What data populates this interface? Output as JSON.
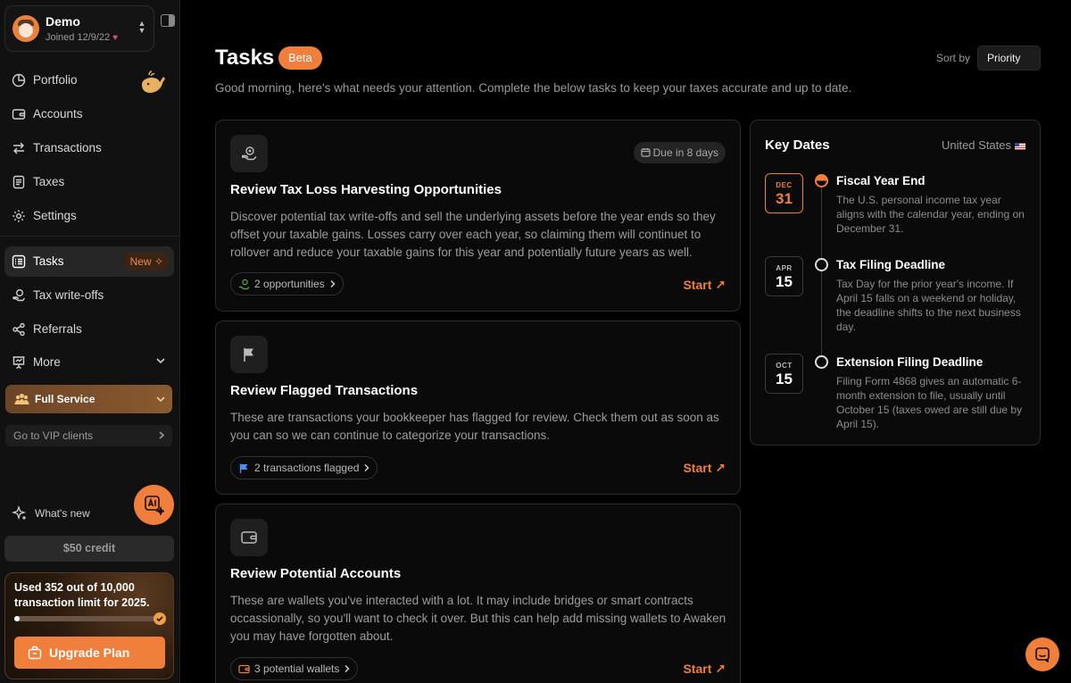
{
  "user": {
    "name": "Demo",
    "joined": "Joined 12/9/22"
  },
  "nav": {
    "portfolio": "Portfolio",
    "accounts": "Accounts",
    "transactions": "Transactions",
    "taxes": "Taxes",
    "settings": "Settings",
    "tasks": "Tasks",
    "tasks_badge": "New",
    "tax_writeoffs": "Tax write-offs",
    "referrals": "Referrals",
    "more": "More"
  },
  "service": {
    "label": "Full Service",
    "vip_link": "Go to VIP clients"
  },
  "whats_new": "What's new",
  "credit": "$50 credit",
  "usage": {
    "text": "Used 352 out of 10,000 transaction limit for 2025.",
    "progress": 0.0352,
    "upgrade": "Upgrade Plan"
  },
  "header": {
    "title": "Tasks",
    "badge": "Beta",
    "sort_label": "Sort by",
    "sort_value": "Priority",
    "subtitle": "Good morning, here's what needs your attention. Complete the below tasks to keep your taxes accurate and up to date."
  },
  "tasks": [
    {
      "title": "Review Tax Loss Harvesting Opportunities",
      "due": "Due in 8 days",
      "description": "Discover potential tax write-offs and sell the underlying assets before the year ends so they offset your taxable gains. Losses carry over each year, so claiming them will continuet to rollover and reduce your taxable gains for this year and potentially future years as well.",
      "chip": "2 opportunities",
      "action": "Start"
    },
    {
      "title": "Review Flagged Transactions",
      "description": "These are transactions your bookkeeper has flagged for review. Check them out as soon as you can so we can continue to categorize your transactions.",
      "chip": "2 transactions flagged",
      "action": "Start"
    },
    {
      "title": "Review Potential Accounts",
      "description": "These are wallets you've interacted with a lot. It may include bridges or smart contracts occassionally, so you'll want to check it over. But this can help add missing wallets to Awaken you may have forgotten about.",
      "chip": "3 potential wallets",
      "action": "Start"
    }
  ],
  "key_dates": {
    "title": "Key Dates",
    "country": "United States",
    "items": [
      {
        "month": "DEC",
        "day": "31",
        "name": "Fiscal Year End",
        "description": "The U.S. personal income tax year aligns with the calendar year, ending on December 31."
      },
      {
        "month": "APR",
        "day": "15",
        "name": "Tax Filing Deadline",
        "description": "Tax Day for the prior year's income. If April 15 falls on a weekend or holiday, the deadline shifts to the next business day."
      },
      {
        "month": "OCT",
        "day": "15",
        "name": "Extension Filing Deadline",
        "description": "Filing Form 4868 gives an automatic 6-month extension to file, usually until October 15 (taxes owed are still due by April 15)."
      }
    ]
  },
  "colors": {
    "accent": "#f07f3c",
    "background": "#000000",
    "sidebar": "#111111"
  }
}
